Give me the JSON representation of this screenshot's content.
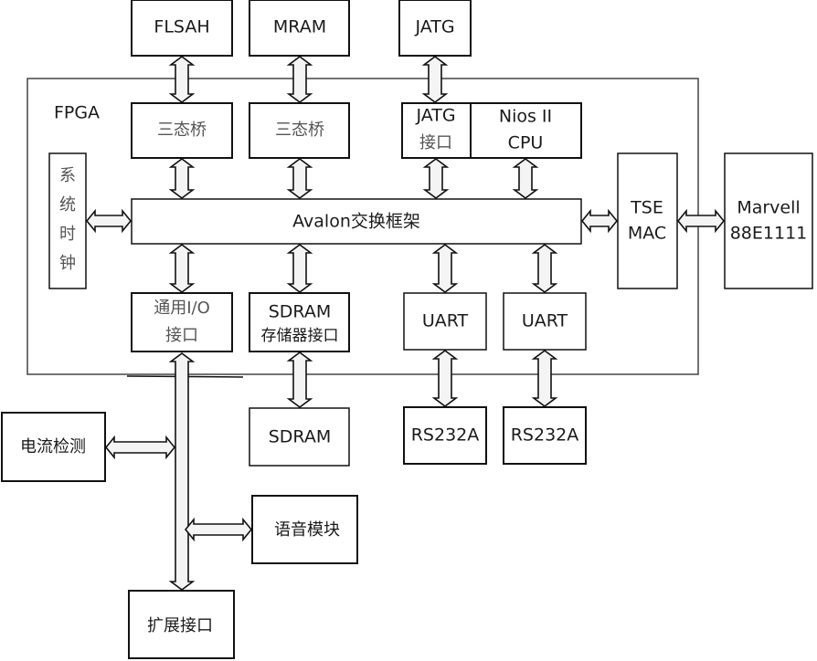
{
  "diagram": {
    "fpga_label": "FPGA",
    "external_top": {
      "flash": "FLSAH",
      "mram": "MRAM",
      "jtag": "JATG"
    },
    "fpga_blocks": {
      "tristate_bridge_1": "三态桥",
      "tristate_bridge_2": "三态桥",
      "jtag_interface": [
        "JATG",
        "接口"
      ],
      "nios_cpu": [
        "Nios II",
        "CPU"
      ],
      "system_clock": [
        "系",
        "统",
        "时",
        "钟"
      ],
      "avalon": "Avalon交换框架",
      "tse_mac": [
        "TSE",
        "MAC"
      ],
      "gpio_interface": [
        "通用I/O",
        "接口"
      ],
      "sdram_interface": [
        "SDRAM",
        "存储器接口"
      ],
      "uart_1": "UART",
      "uart_2": "UART"
    },
    "external_right": {
      "phy": [
        "Marvell",
        "88E1111"
      ]
    },
    "external_bottom": {
      "sdram": "SDRAM",
      "rs232_1": "RS232A",
      "rs232_2": "RS232A",
      "current_detect": "电流检测",
      "voice_module": "语音模块",
      "expansion_interface": "扩展接口"
    },
    "connections": [
      [
        "FLSAH",
        "三态桥"
      ],
      [
        "MRAM",
        "三态桥"
      ],
      [
        "JATG",
        "JATG接口"
      ],
      [
        "三态桥",
        "Avalon交换框架"
      ],
      [
        "三态桥",
        "Avalon交换框架"
      ],
      [
        "JATG接口",
        "Avalon交换框架"
      ],
      [
        "Nios II CPU",
        "Avalon交换框架"
      ],
      [
        "系统时钟",
        "Avalon交换框架"
      ],
      [
        "Avalon交换框架",
        "TSE MAC"
      ],
      [
        "TSE MAC",
        "Marvell 88E1111"
      ],
      [
        "Avalon交换框架",
        "通用I/O接口"
      ],
      [
        "Avalon交换框架",
        "SDRAM存储器接口"
      ],
      [
        "Avalon交换框架",
        "UART"
      ],
      [
        "Avalon交换框架",
        "UART"
      ],
      [
        "SDRAM存储器接口",
        "SDRAM"
      ],
      [
        "UART",
        "RS232A"
      ],
      [
        "UART",
        "RS232A"
      ],
      [
        "通用I/O接口",
        "扩展接口"
      ],
      [
        "电流检测",
        "通用I/O总线"
      ],
      [
        "语音模块",
        "通用I/O总线"
      ]
    ]
  }
}
